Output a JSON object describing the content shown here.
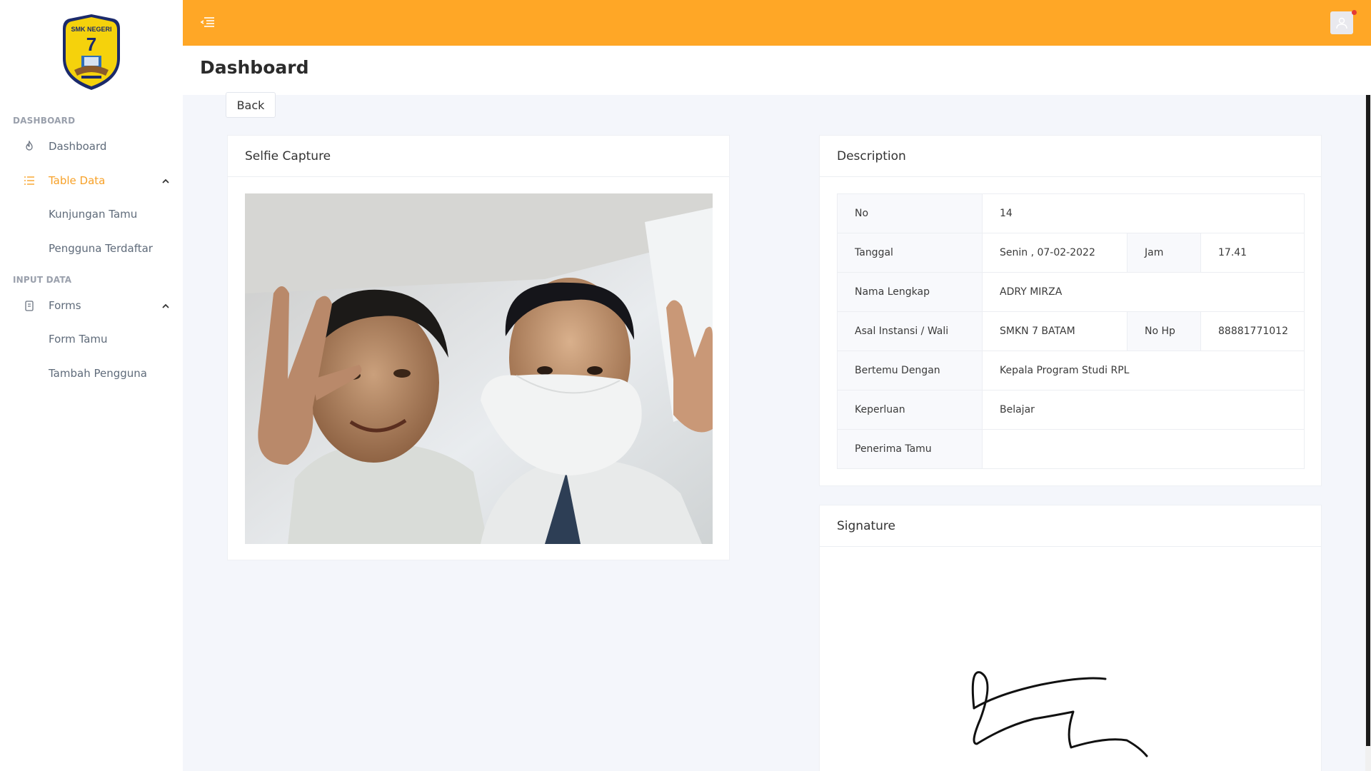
{
  "sidebar": {
    "logo": {
      "top_text": "SMK NEGERI",
      "number": "7"
    },
    "sections": [
      "DASHBOARD",
      "INPUT DATA"
    ],
    "items": [
      {
        "label": "Dashboard",
        "icon": "fire-icon"
      },
      {
        "label": "Table Data",
        "icon": "list-icon",
        "active": true
      },
      {
        "label": "Kunjungan Tamu"
      },
      {
        "label": "Pengguna Terdaftar"
      },
      {
        "label": "Forms",
        "icon": "clipboard-icon"
      },
      {
        "label": "Form Tamu"
      },
      {
        "label": "Tambah Pengguna"
      }
    ]
  },
  "topbar": {
    "accent_color": "#ffa726"
  },
  "header": {
    "title": "Dashboard"
  },
  "back_label": "Back",
  "selfie": {
    "title": "Selfie Capture"
  },
  "description": {
    "title": "Description",
    "no_label": "No",
    "no_value": "14",
    "tanggal_label": "Tanggal",
    "tanggal_value": "Senin , 07-02-2022",
    "jam_label": "Jam",
    "jam_value": "17.41",
    "nama_label": "Nama Lengkap",
    "nama_value": "ADRY MIRZA",
    "asal_label": "Asal Instansi / Wali",
    "asal_value": "SMKN 7 BATAM",
    "hp_label": "No Hp",
    "hp_value": "88881771012",
    "bertemu_label": "Bertemu Dengan",
    "bertemu_value": "Kepala Program Studi RPL",
    "keperluan_label": "Keperluan",
    "keperluan_value": "Belajar",
    "penerima_label": "Penerima Tamu",
    "penerima_value": ""
  },
  "signature": {
    "title": "Signature"
  }
}
